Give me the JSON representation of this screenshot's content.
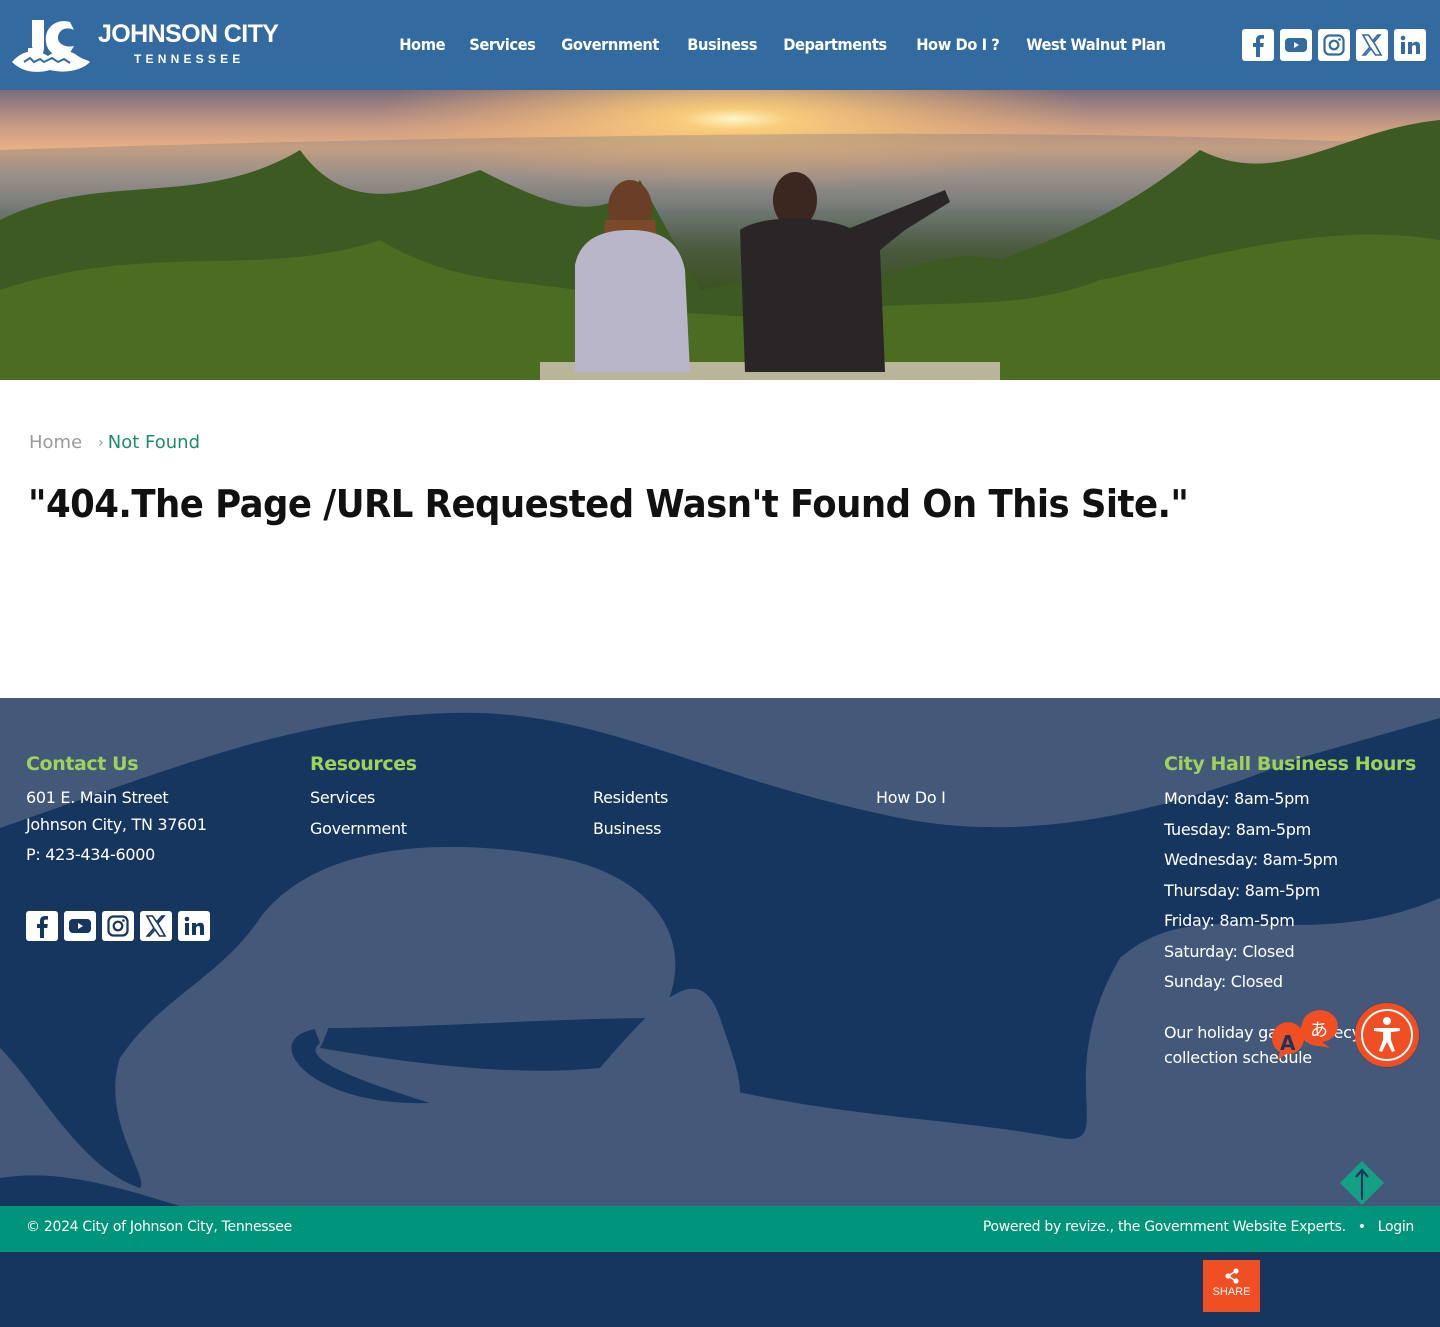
{
  "header": {
    "logo": {
      "name": "JOHNSON CITY",
      "sub": "TENNESSEE"
    },
    "nav": [
      "Home",
      "Services",
      "Government",
      "Business",
      "Departments",
      "How Do I ?",
      "West Walnut Plan"
    ],
    "social": [
      "facebook-icon",
      "youtube-icon",
      "instagram-icon",
      "x-icon",
      "linkedin-icon"
    ]
  },
  "hero": {
    "alt": "Two people sitting on a bench overlooking a sunset over forested hills"
  },
  "breadcrumb": {
    "home": "Home",
    "separator": "›",
    "current": "Not Found"
  },
  "page_title": "\"404.The Page /URL Requested Wasn't Found On This Site.\"",
  "footer": {
    "contact": {
      "heading": "Contact Us",
      "lines": [
        "601 E. Main Street",
        "Johnson City, TN 37601",
        "P: 423-434-6000"
      ]
    },
    "resources": {
      "heading": "Resources",
      "links": [
        "Services",
        "Government",
        "Residents",
        "Business",
        "How Do I"
      ]
    },
    "hours": {
      "heading": "City Hall Business Hours",
      "lines": [
        "Monday: 8am-5pm",
        "Tuesday: 8am-5pm",
        "Wednesday: 8am-5pm",
        "Thursday: 8am-5pm",
        "Friday: 8am-5pm",
        "Saturday: Closed",
        "Sunday: Closed"
      ],
      "note_line1": "Our holiday garbage/recycling",
      "note_line2": "collection schedule"
    },
    "copyright": "© 2024 City of Johnson City, Tennessee",
    "powered_by": "Powered by revize., the Government Website Experts.",
    "bullet": "•",
    "login": "Login"
  },
  "widgets": {
    "share_label": "SHARE"
  },
  "colors": {
    "header_bg": "#336aa0",
    "accent_green": "#9ed35b",
    "teal": "#00957a",
    "footer_dark": "#17365f",
    "footer_light": "#44597a",
    "orange": "#f04e23",
    "breadcrumb_current": "#1a8d6e"
  }
}
